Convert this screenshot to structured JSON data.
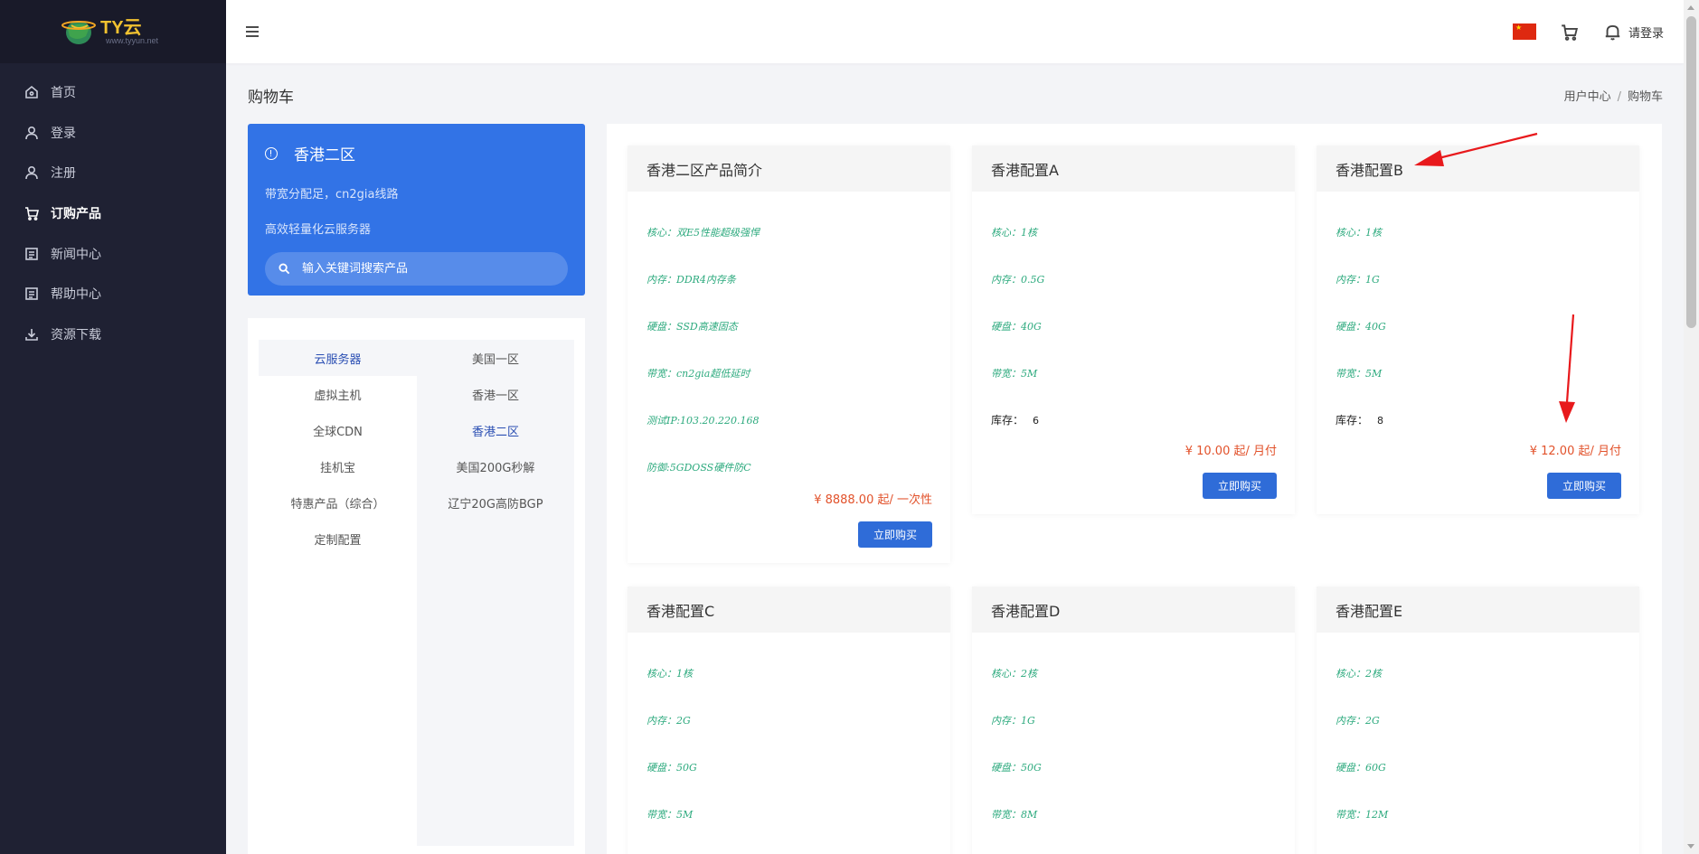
{
  "logo": {
    "text": "TY云",
    "sub": "www.tyyun.net"
  },
  "sidebar": {
    "items": [
      {
        "label": "首页",
        "icon": "home-icon"
      },
      {
        "label": "登录",
        "icon": "user-icon"
      },
      {
        "label": "注册",
        "icon": "user-icon"
      },
      {
        "label": "订购产品",
        "icon": "cart-icon",
        "active": true
      },
      {
        "label": "新闻中心",
        "icon": "document-icon"
      },
      {
        "label": "帮助中心",
        "icon": "document-icon"
      },
      {
        "label": "资源下载",
        "icon": "download-icon"
      }
    ]
  },
  "header": {
    "login": "请登录",
    "flag": "china-flag"
  },
  "page": {
    "title": "购物车"
  },
  "breadcrumb": {
    "home": "用户中心",
    "sep": "/",
    "current": "购物车"
  },
  "region": {
    "title": "香港二区",
    "desc1": "带宽分配足，cn2gia线路",
    "desc2": "高效轻量化云服务器",
    "search_placeholder": "输入关键词搜索产品"
  },
  "categories": {
    "left": [
      "云服务器",
      "虚拟主机",
      "全球CDN",
      "挂机宝",
      "特惠产品（综合）",
      "定制配置"
    ],
    "right": [
      "美国一区",
      "香港一区",
      "香港二区",
      "美国200G秒解",
      "辽宁20G高防BGP"
    ]
  },
  "products": [
    {
      "title": "香港二区产品简介",
      "specs": [
        "核心：双E5性能超级强悍",
        "内存：DDR4内存条",
        "硬盘：SSD高速固态",
        "带宽：cn2gia超低延时",
        "测试IP:103.20.220.168",
        "防御:5GDOSS硬件防C"
      ],
      "price": "¥ 8888.00 起/ 一次性",
      "buy": "立即购买"
    },
    {
      "title": "香港配置A",
      "specs": [
        "核心：1核",
        "内存：0.5G",
        "硬盘：40G",
        "带宽：5M"
      ],
      "stock_label": "库存：",
      "stock": "6",
      "price": "¥ 10.00 起/ 月付",
      "buy": "立即购买"
    },
    {
      "title": "香港配置B",
      "specs": [
        "核心：1核",
        "内存：1G",
        "硬盘：40G",
        "带宽：5M"
      ],
      "stock_label": "库存：",
      "stock": "8",
      "price": "¥ 12.00 起/ 月付",
      "buy": "立即购买"
    },
    {
      "title": "香港配置C",
      "specs": [
        "核心：1核",
        "内存：2G",
        "硬盘：50G",
        "带宽：5M"
      ]
    },
    {
      "title": "香港配置D",
      "specs": [
        "核心：2核",
        "内存：1G",
        "硬盘：50G",
        "带宽：8M"
      ]
    },
    {
      "title": "香港配置E",
      "specs": [
        "核心：2核",
        "内存：2G",
        "硬盘：60G",
        "带宽：12M"
      ]
    }
  ],
  "colors": {
    "sidebar": "#1f2133",
    "accent": "#3273e6",
    "price": "#e2522b",
    "spec": "#2daa7e",
    "annotation": "#e8191c"
  }
}
